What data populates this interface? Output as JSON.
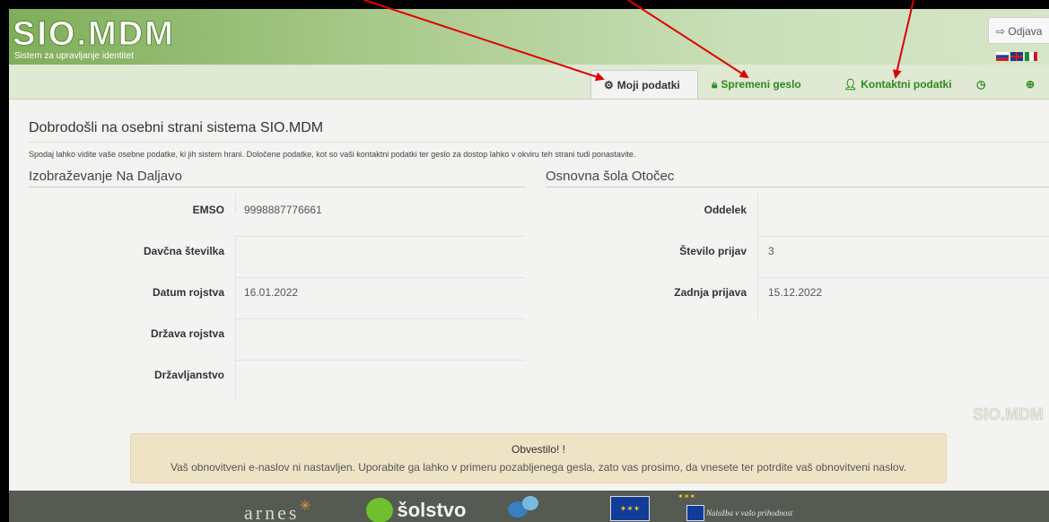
{
  "header": {
    "logo_text": "SIO.MDM",
    "tagline": "Sistem za upravljanje identitet",
    "logout_label": "Odjava"
  },
  "nav": {
    "tabs": [
      {
        "label": "Moji podatki"
      },
      {
        "label": "Spremeni geslo"
      },
      {
        "label": "Kontaktni podatki"
      }
    ]
  },
  "main": {
    "welcome": "Dobrodošli na osebni strani sistema SIO.MDM",
    "intro": "Spodaj lahko vidite vaše osebne podatke, ki jih sistem hrani. Določene podatke, kot so vaši kontaktni podatki ter geslo za dostop lahko v okviru teh strani tudi ponastavite.",
    "left": {
      "title": "Izobraževanje Na Daljavo",
      "rows": [
        {
          "label": "EMSO",
          "value": "9998887776661"
        },
        {
          "label": "Davčna številka",
          "value": ""
        },
        {
          "label": "Datum rojstva",
          "value": "16.01.2022"
        },
        {
          "label": "Država rojstva",
          "value": ""
        },
        {
          "label": "Državljanstvo",
          "value": ""
        }
      ]
    },
    "right": {
      "title": "Osnovna šola Otočec",
      "rows": [
        {
          "label": "Oddelek",
          "value": ""
        },
        {
          "label": "Število prijav",
          "value": "3"
        },
        {
          "label": "Zadnja prijava",
          "value": "15.12.2022"
        }
      ]
    }
  },
  "notice": {
    "title": "Obvestilo! !",
    "text": "Vaš obnovitveni e-naslov ni nastavljen. Uporabite ga lahko v primeru pozabljenega gesla, zato vas prosimo, da vnesete ter potrdite vaš obnovitveni naslov."
  },
  "footer": {
    "arnes": "arnes",
    "solstvo": "šolstvo",
    "eu_caption": "Naložba v vašo prihodnost"
  },
  "colors": {
    "accent": "#2f8a1e",
    "arrow": "#e00000",
    "notice_bg": "#efe3c5"
  }
}
